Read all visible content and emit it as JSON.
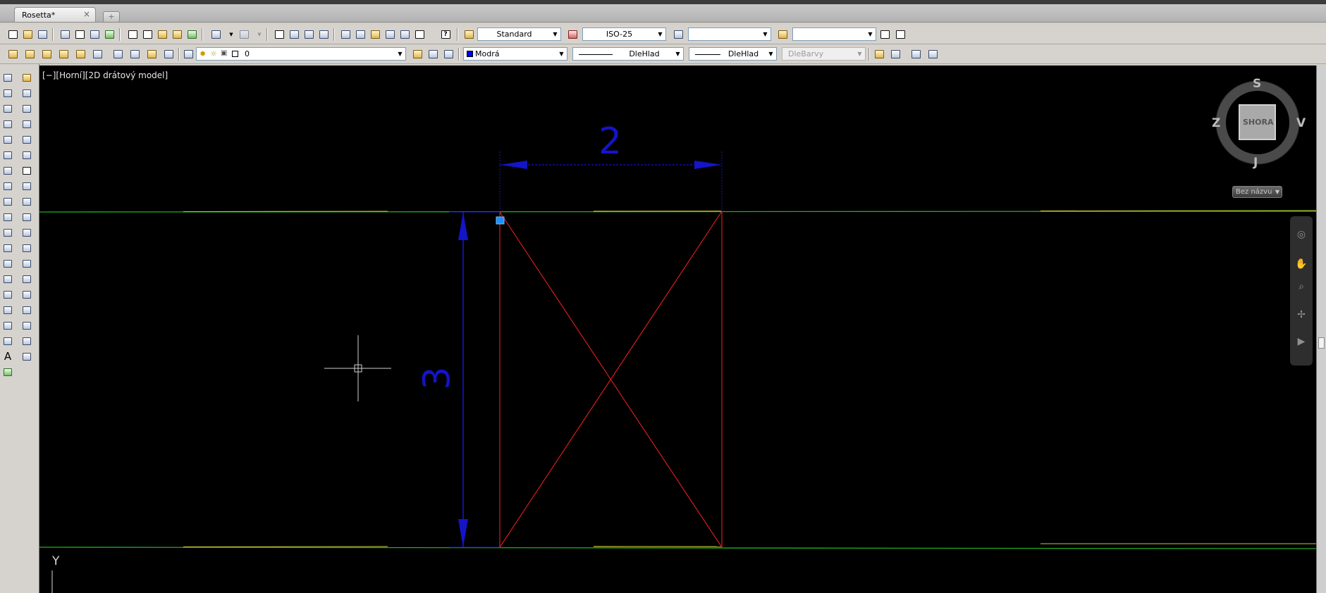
{
  "document_tab": {
    "title": "Rosetta*",
    "close_glyph": "×"
  },
  "new_tab": {
    "glyph": "+"
  },
  "toolbar1": {
    "text_style": "Standard",
    "dim_style": "ISO-25",
    "table_style": "",
    "multileader_style": ""
  },
  "toolbar2": {
    "layer": "0",
    "color": "Modrá",
    "linetype": "DleHlad",
    "lineweight": "DleHlad",
    "plotstyle": "DleBarvy"
  },
  "viewport": {
    "label": "[−][Horní][2D drátový model]",
    "ucs_axis_label": "Y"
  },
  "drawing": {
    "dim_horizontal_value": "2",
    "dim_vertical_value": "3",
    "colors": {
      "border": "#ff2020",
      "dimension": "#1414c8",
      "green": "#1fae1f",
      "yellow": "#c8c832"
    }
  },
  "viewcube": {
    "north": "S",
    "south": "J",
    "east": "V",
    "west": "Z",
    "face": "SHORA"
  },
  "view_name_button": {
    "label": "Bez názvu"
  },
  "dropdown_arrow": "▼"
}
